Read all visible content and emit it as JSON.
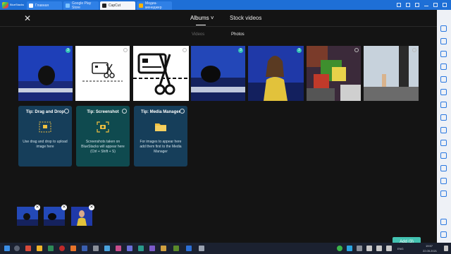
{
  "titlebar": {
    "app_name": "BlueStacks",
    "tabs": [
      {
        "label": "Главная",
        "icon": "home-icon"
      },
      {
        "label": "Google Play Store",
        "icon": "play-store-icon"
      },
      {
        "label": "CapCut",
        "icon": "capcut-icon"
      },
      {
        "label": "Медиа-менеджер",
        "icon": "media-manager-icon"
      }
    ]
  },
  "header": {
    "tabs": [
      {
        "label": "Albums ˅"
      },
      {
        "label": "Stock videos"
      }
    ],
    "sub_tabs": [
      {
        "label": "Videos"
      },
      {
        "label": "Photos"
      }
    ]
  },
  "photos": [
    {
      "name": "news-chair-photo",
      "badge": "3"
    },
    {
      "name": "card-scissors-photo-small",
      "badge": ""
    },
    {
      "name": "card-scissors-photo-large",
      "badge": ""
    },
    {
      "name": "news-chair-photo-2",
      "badge": "3"
    },
    {
      "name": "woman-presenter-photo",
      "badge": "3"
    },
    {
      "name": "minecraft-flowers-photo",
      "badge": ""
    },
    {
      "name": "minecraft-pillar-photo",
      "badge": ""
    }
  ],
  "tips": [
    {
      "title": "Tip: Drag and Drop",
      "text": "Use drag and drop to upload image here",
      "icon": "drag-drop-icon"
    },
    {
      "title": "Tip: Screenshot",
      "text": "Screenshots taken on BlueStacks will appear here (Ctrl + Shift + S)",
      "icon": "screenshot-icon"
    },
    {
      "title": "Tip: Media Manager",
      "text": "For images to appear here add them first to the Media Manager",
      "icon": "folder-icon"
    }
  ],
  "selected_count_button": "Add (3)",
  "taskbar": {
    "lang": "ENG",
    "time": "19:57",
    "date": "22.05.2021"
  },
  "colors": {
    "accent": "#43c3b2",
    "titlebar": "#1e6fd6",
    "background": "#141414"
  }
}
